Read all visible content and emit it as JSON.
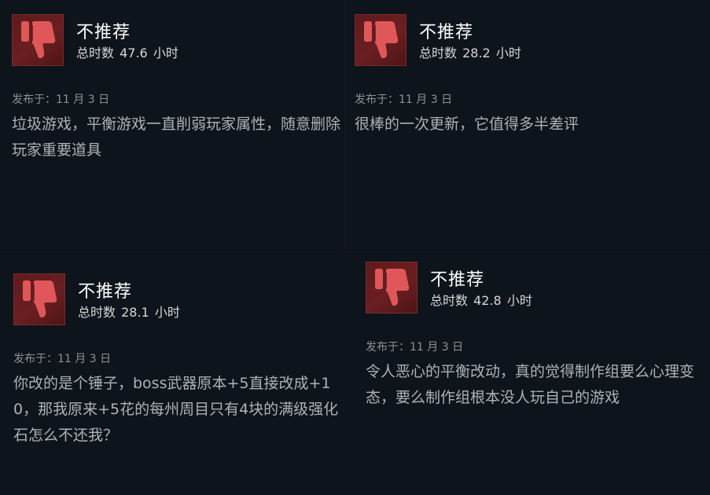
{
  "reviews": [
    {
      "verdict": "不推荐",
      "hours_label": "总时数",
      "hours": "47.6",
      "hours_unit": "小时",
      "posted": "发布于：11 月 3 日",
      "body": "垃圾游戏，平衡游戏一直削弱玩家属性，随意删除玩家重要道具",
      "icon": "thumbs-down-icon"
    },
    {
      "verdict": "不推荐",
      "hours_label": "总时数",
      "hours": "28.2",
      "hours_unit": "小时",
      "posted": "发布于：11 月 3 日",
      "body": "很棒的一次更新，它值得多半差评",
      "icon": "thumbs-down-icon"
    },
    {
      "verdict": "不推荐",
      "hours_label": "总时数",
      "hours": "28.1",
      "hours_unit": "小时",
      "posted": "发布于：11 月 3 日",
      "body": "你改的是个锤子，boss武器原本+5直接改成+10，那我原来+5花的每州周目只有4块的满级强化石怎么不还我？",
      "icon": "thumbs-down-icon"
    },
    {
      "verdict": "不推荐",
      "hours_label": "总时数",
      "hours": "42.8",
      "hours_unit": "小时",
      "posted": "发布于：11 月 3 日",
      "body": "令人恶心的平衡改动，真的觉得制作组要么心理变态，要么制作组根本没人玩自己的游戏",
      "icon": "thumbs-down-icon"
    }
  ],
  "colors": {
    "page_bg": "#0e141b",
    "badge_bg": "#5e1a1c",
    "thumb_fill": "#e0575a",
    "verdict_text": "#ffffff",
    "hours_text": "#d6d7d8",
    "posted_text": "#8d9296",
    "body_text": "#acb2b8"
  }
}
